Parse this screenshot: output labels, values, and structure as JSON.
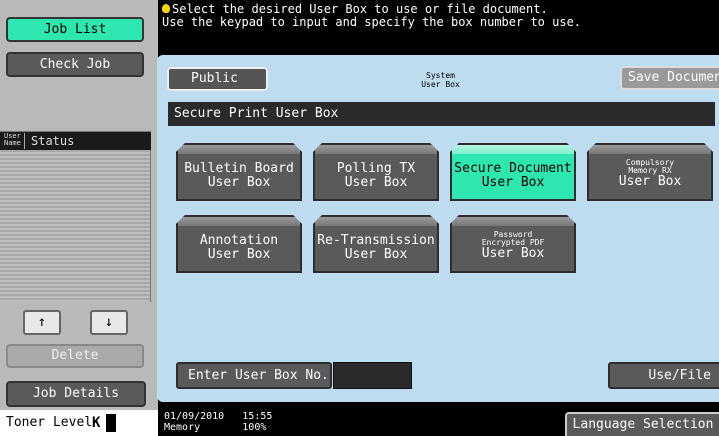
{
  "sidebar": {
    "job_list": "Job List",
    "check_job": "Check Job",
    "col_user_name_1": "User",
    "col_user_name_2": "Name",
    "col_status": "Status",
    "up_arrow": "↑",
    "down_arrow": "↓",
    "delete": "Delete",
    "job_details": "Job Details",
    "toner_level": "Toner Level",
    "toner_color": "K"
  },
  "message": {
    "line1": "Select the desired User Box to use or file document.",
    "line2": "Use the keypad to input and specify the box number to use."
  },
  "tabs": {
    "public": "Public",
    "system_1": "System",
    "system_2": "User Box",
    "save_document": "Save Document"
  },
  "section_title": "Secure Print User Box",
  "boxes": [
    {
      "line1": "Bulletin Board",
      "line2": "User Box"
    },
    {
      "line1": "Polling TX",
      "line2": "User Box"
    },
    {
      "line1": "Secure Document",
      "line2": "User Box",
      "selected": true
    },
    {
      "small1": "Compulsory",
      "small2": "Memory RX",
      "line2": "User Box"
    },
    {
      "line1": "Annotation",
      "line2": "User Box"
    },
    {
      "line1": "Re-Transmission",
      "line2": "User Box"
    },
    {
      "small1": "Password",
      "small2": "Encrypted PDF",
      "line2": "User Box"
    }
  ],
  "enter_box_label": "Enter User Box No.",
  "use_file": "Use/File",
  "footer": {
    "date": "01/09/2010",
    "time": "15:55",
    "memory_label": "Memory",
    "memory_value": "100%",
    "language_selection": "Language Selection"
  },
  "colors": {
    "accent": "#2ee6b0",
    "panel": "#bedcf0"
  }
}
